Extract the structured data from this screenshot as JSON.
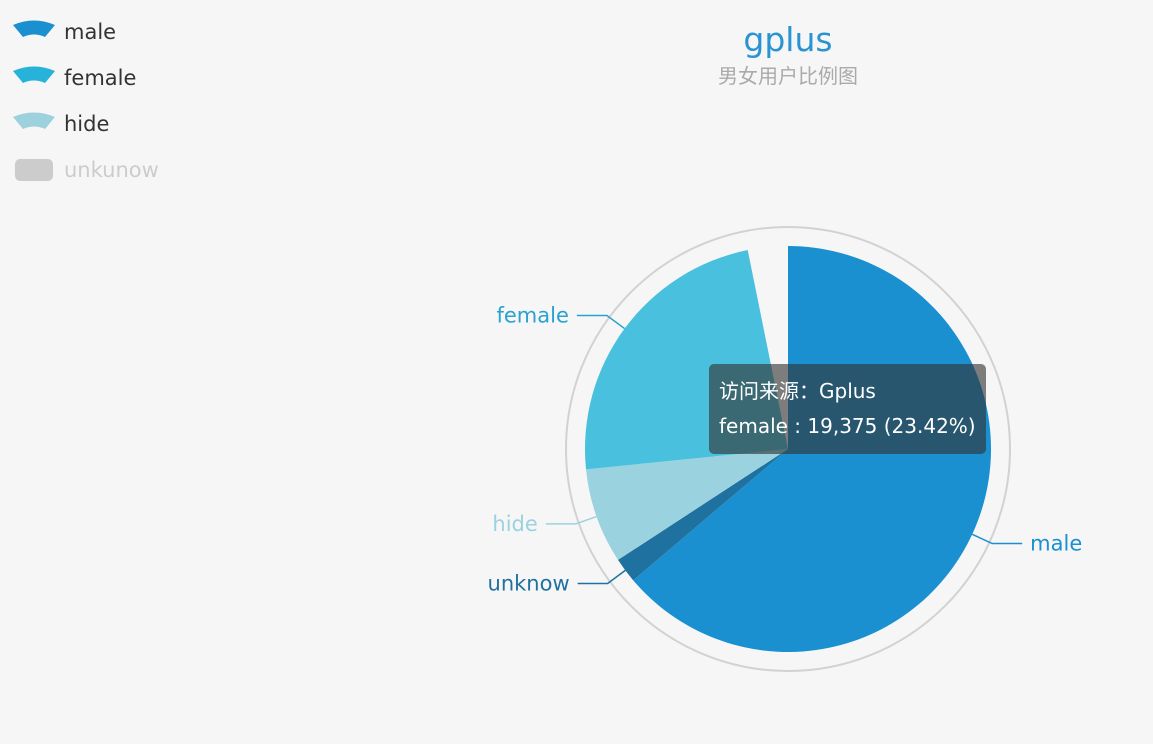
{
  "chart_data": {
    "type": "pie",
    "title": "gplus",
    "subtitle": "男女用户比例图",
    "legend": [
      {
        "name": "male",
        "color": "#1a90d0",
        "selected": true
      },
      {
        "name": "female",
        "color": "#27b2d9",
        "selected": true
      },
      {
        "name": "hide",
        "color": "#9ed1de",
        "selected": true
      },
      {
        "name": "unkunow",
        "color": "#cccccc",
        "selected": false
      }
    ],
    "slices": [
      {
        "name": "male",
        "percent": 63.8,
        "color": "#1a90d0",
        "label_color": "#1a90d0"
      },
      {
        "name": "unknow",
        "percent": 2.0,
        "color": "#1f72a0",
        "label_color": "#1f72a0"
      },
      {
        "name": "hide",
        "percent": 7.6,
        "color": "#9ad3df",
        "label_color": "#9ad3df"
      },
      {
        "name": "female",
        "value": 19375,
        "percent": 23.42,
        "color": "#48c0de",
        "label_color": "#2aa2cf"
      }
    ],
    "legend_position": "top-left",
    "tooltip": {
      "line1": "访问来源：Gplus",
      "line2": "female : 19,375 (23.42%)"
    }
  }
}
